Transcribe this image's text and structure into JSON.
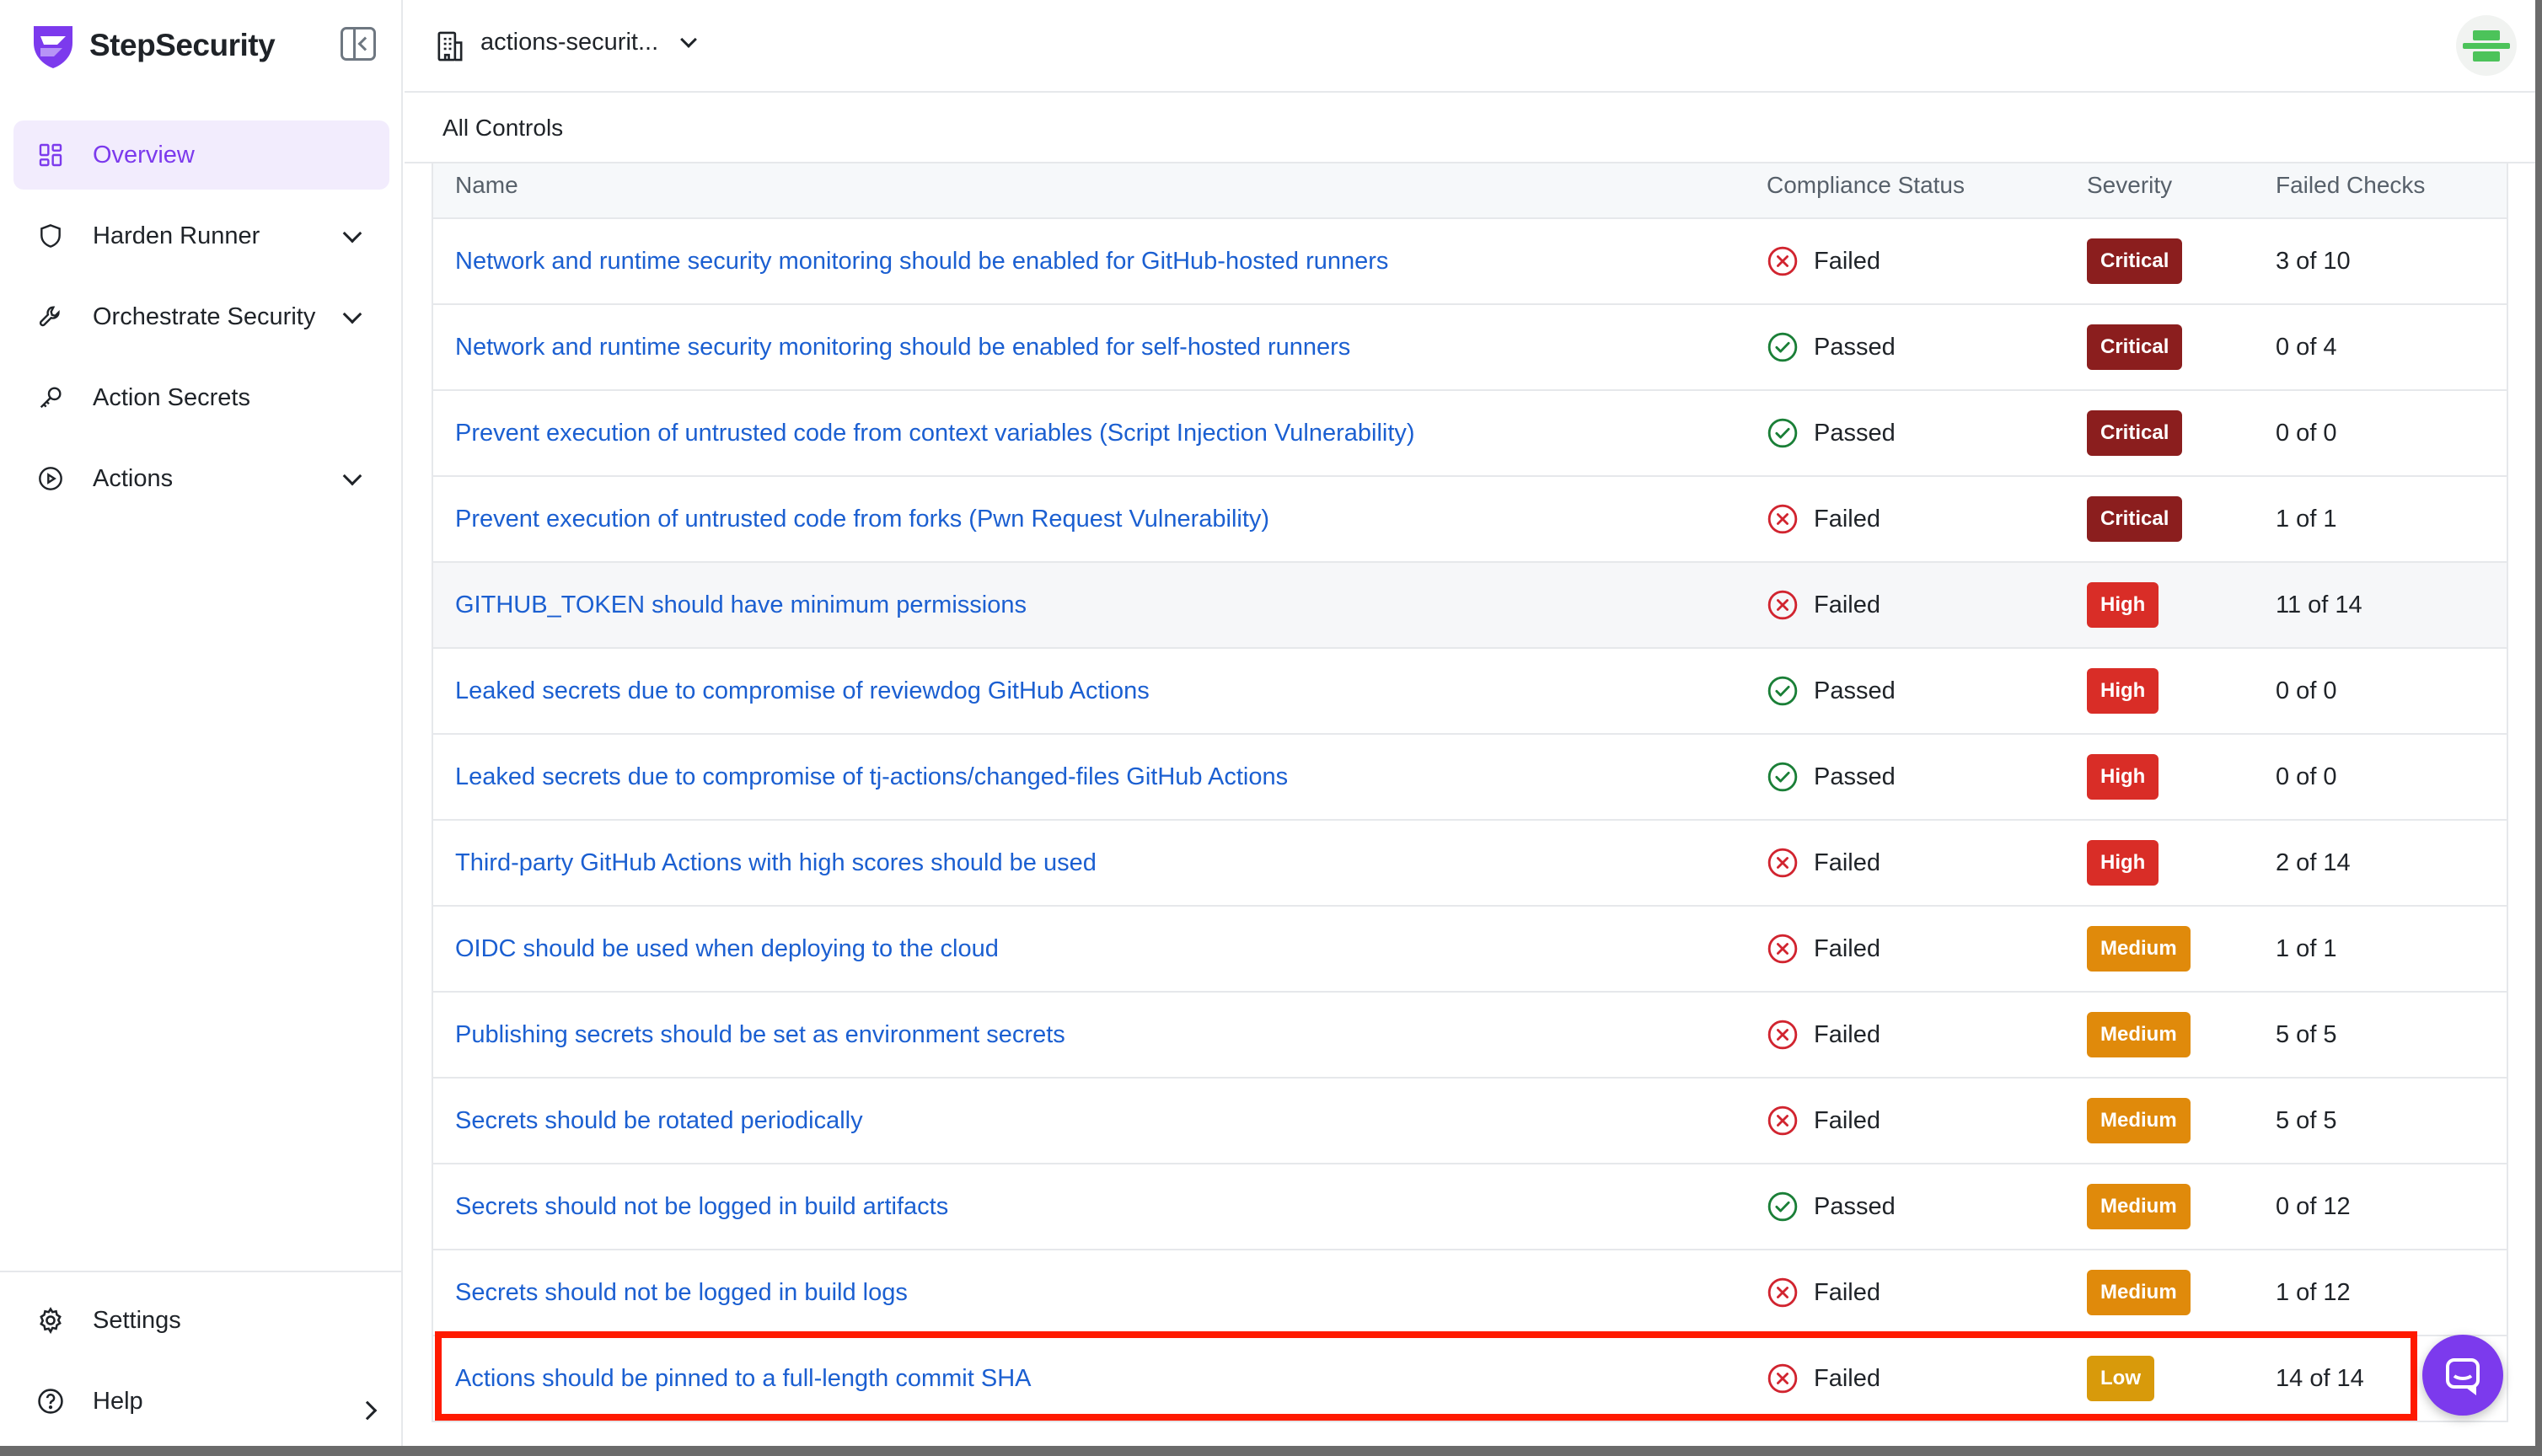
{
  "brand": {
    "name": "StepSecurity"
  },
  "sidebar": {
    "items": [
      {
        "label": "Overview",
        "icon": "grid-icon",
        "active": true,
        "chevron": ""
      },
      {
        "label": "Harden Runner",
        "icon": "shield-icon",
        "active": false,
        "chevron": "down"
      },
      {
        "label": "Orchestrate Security",
        "icon": "wrench-icon",
        "active": false,
        "chevron": "down"
      },
      {
        "label": "Action Secrets",
        "icon": "key-icon",
        "active": false,
        "chevron": ""
      },
      {
        "label": "Actions",
        "icon": "play-circle-icon",
        "active": false,
        "chevron": "down"
      }
    ],
    "settings_label": "Settings",
    "help_label": "Help"
  },
  "topbar": {
    "org_name": "actions-securit..."
  },
  "section": {
    "title": "All Controls"
  },
  "table": {
    "columns": [
      "Name",
      "Compliance Status",
      "Severity",
      "Failed Checks"
    ],
    "rows": [
      {
        "name": "Network and runtime security monitoring should be enabled for GitHub-hosted runners",
        "status": "Failed",
        "severity": "Critical",
        "failed": "3 of 10"
      },
      {
        "name": "Network and runtime security monitoring should be enabled for self-hosted runners",
        "status": "Passed",
        "severity": "Critical",
        "failed": "0 of 4"
      },
      {
        "name": "Prevent execution of untrusted code from context variables (Script Injection Vulnerability)",
        "status": "Passed",
        "severity": "Critical",
        "failed": "0 of 0"
      },
      {
        "name": "Prevent execution of untrusted code from forks (Pwn Request Vulnerability)",
        "status": "Failed",
        "severity": "Critical",
        "failed": "1 of 1"
      },
      {
        "name": "GITHUB_TOKEN should have minimum permissions",
        "status": "Failed",
        "severity": "High",
        "failed": "11 of 14"
      },
      {
        "name": "Leaked secrets due to compromise of reviewdog GitHub Actions",
        "status": "Passed",
        "severity": "High",
        "failed": "0 of 0"
      },
      {
        "name": "Leaked secrets due to compromise of tj-actions/changed-files GitHub Actions",
        "status": "Passed",
        "severity": "High",
        "failed": "0 of 0"
      },
      {
        "name": "Third-party GitHub Actions with high scores should be used",
        "status": "Failed",
        "severity": "High",
        "failed": "2 of 14"
      },
      {
        "name": "OIDC should be used when deploying to the cloud",
        "status": "Failed",
        "severity": "Medium",
        "failed": "1 of 1"
      },
      {
        "name": "Publishing secrets should be set as environment secrets",
        "status": "Failed",
        "severity": "Medium",
        "failed": "5 of 5"
      },
      {
        "name": "Secrets should be rotated periodically",
        "status": "Failed",
        "severity": "Medium",
        "failed": "5 of 5"
      },
      {
        "name": "Secrets should not be logged in build artifacts",
        "status": "Passed",
        "severity": "Medium",
        "failed": "0 of 12"
      },
      {
        "name": "Secrets should not be logged in build logs",
        "status": "Failed",
        "severity": "Medium",
        "failed": "1 of 12"
      },
      {
        "name": "Actions should be pinned to a full-length commit SHA",
        "status": "Failed",
        "severity": "Low",
        "failed": "14 of 14"
      }
    ]
  },
  "colors": {
    "accent": "#7c3aed",
    "link": "#1b5fd1",
    "failed": "#d1242f",
    "passed": "#1a7f37",
    "critical": "#8b1e1e",
    "high": "#d92d27",
    "medium": "#e08a0b",
    "low": "#d89a0b",
    "highlight": "#ff1a00"
  }
}
